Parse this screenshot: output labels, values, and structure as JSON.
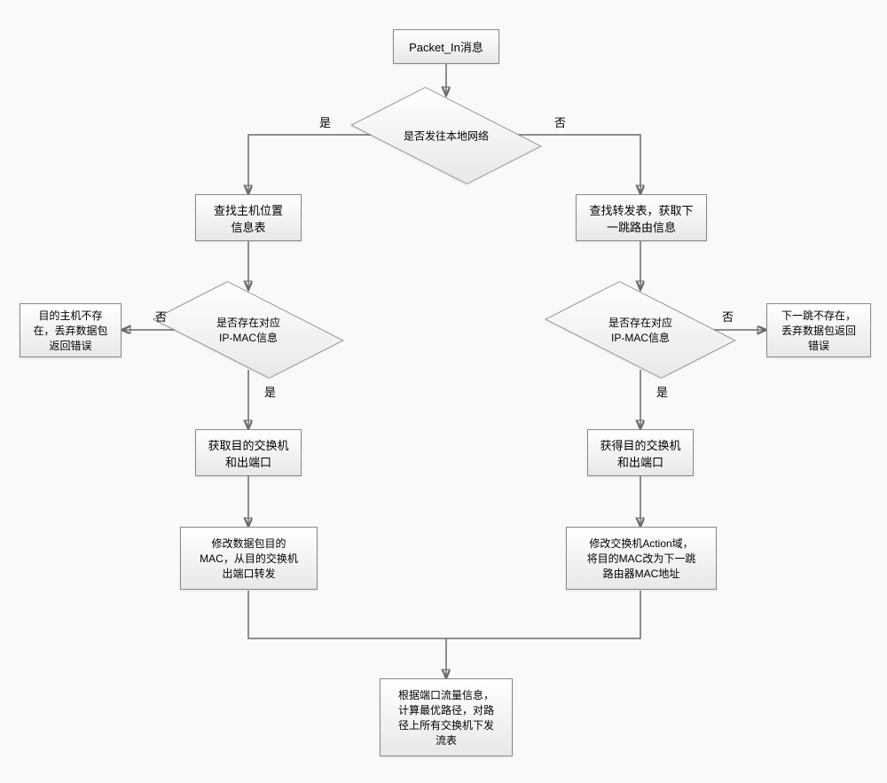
{
  "chart_data": {
    "type": "flowchart",
    "nodes": [
      {
        "id": "start",
        "text": "Packet_In消息",
        "shape": "rect"
      },
      {
        "id": "d1",
        "text": "是否发往本地网络",
        "shape": "diamond"
      },
      {
        "id": "l1",
        "text": "查找主机位置\n信息表",
        "shape": "rect"
      },
      {
        "id": "r1",
        "text": "查找转发表，获取下\n一跳路由信息",
        "shape": "rect"
      },
      {
        "id": "d2",
        "text": "是否存在对应\nIP-MAC信息",
        "shape": "diamond"
      },
      {
        "id": "d3",
        "text": "是否存在对应\nIP-MAC信息",
        "shape": "diamond"
      },
      {
        "id": "e1",
        "text": "目的主机不存\n在，丢弃数据包\n返回错误",
        "shape": "rect"
      },
      {
        "id": "e2",
        "text": "下一跳不存在，\n丢弃数据包返回\n错误",
        "shape": "rect"
      },
      {
        "id": "l2",
        "text": "获取目的交换机\n和出端口",
        "shape": "rect"
      },
      {
        "id": "r2",
        "text": "获得目的交换机\n和出端口",
        "shape": "rect"
      },
      {
        "id": "l3",
        "text": "修改数据包目的\nMAC，从目的交换机\n出端口转发",
        "shape": "rect"
      },
      {
        "id": "r3",
        "text": "修改交换机Action域，\n将目的MAC改为下一跳\n路由器MAC地址",
        "shape": "rect"
      },
      {
        "id": "end",
        "text": "根据端口流量信息，\n计算最优路径，对路\n径上所有交换机下发\n流表",
        "shape": "rect"
      }
    ],
    "edges": [
      {
        "from": "start",
        "to": "d1"
      },
      {
        "from": "d1",
        "to": "l1",
        "label": "是"
      },
      {
        "from": "d1",
        "to": "r1",
        "label": "否"
      },
      {
        "from": "l1",
        "to": "d2"
      },
      {
        "from": "r1",
        "to": "d3"
      },
      {
        "from": "d2",
        "to": "e1",
        "label": "否"
      },
      {
        "from": "d2",
        "to": "l2",
        "label": "是"
      },
      {
        "from": "d3",
        "to": "e2",
        "label": "否"
      },
      {
        "from": "d3",
        "to": "r2",
        "label": "是"
      },
      {
        "from": "l2",
        "to": "l3"
      },
      {
        "from": "r2",
        "to": "r3"
      },
      {
        "from": "l3",
        "to": "end"
      },
      {
        "from": "r3",
        "to": "end"
      }
    ]
  },
  "nodes": {
    "start": "Packet_In消息",
    "d1": "是否发往本地网络",
    "l1_line1": "查找主机位置",
    "l1_line2": "信息表",
    "r1_line1": "查找转发表，获取下",
    "r1_line2": "一跳路由信息",
    "d2_line1": "是否存在对应",
    "d2_line2": "IP-MAC信息",
    "d3_line1": "是否存在对应",
    "d3_line2": "IP-MAC信息",
    "e1_line1": "目的主机不存",
    "e1_line2": "在，丢弃数据包",
    "e1_line3": "返回错误",
    "e2_line1": "下一跳不存在，",
    "e2_line2": "丢弃数据包返回",
    "e2_line3": "错误",
    "l2_line1": "获取目的交换机",
    "l2_line2": "和出端口",
    "r2_line1": "获得目的交换机",
    "r2_line2": "和出端口",
    "l3_line1": "修改数据包目的",
    "l3_line2": "MAC，从目的交换机",
    "l3_line3": "出端口转发",
    "r3_line1": "修改交换机Action域，",
    "r3_line2": "将目的MAC改为下一跳",
    "r3_line3": "路由器MAC地址",
    "end_line1": "根据端口流量信息，",
    "end_line2": "计算最优路径，对路",
    "end_line3": "径上所有交换机下发",
    "end_line4": "流表"
  },
  "labels": {
    "yes": "是",
    "no": "否"
  }
}
